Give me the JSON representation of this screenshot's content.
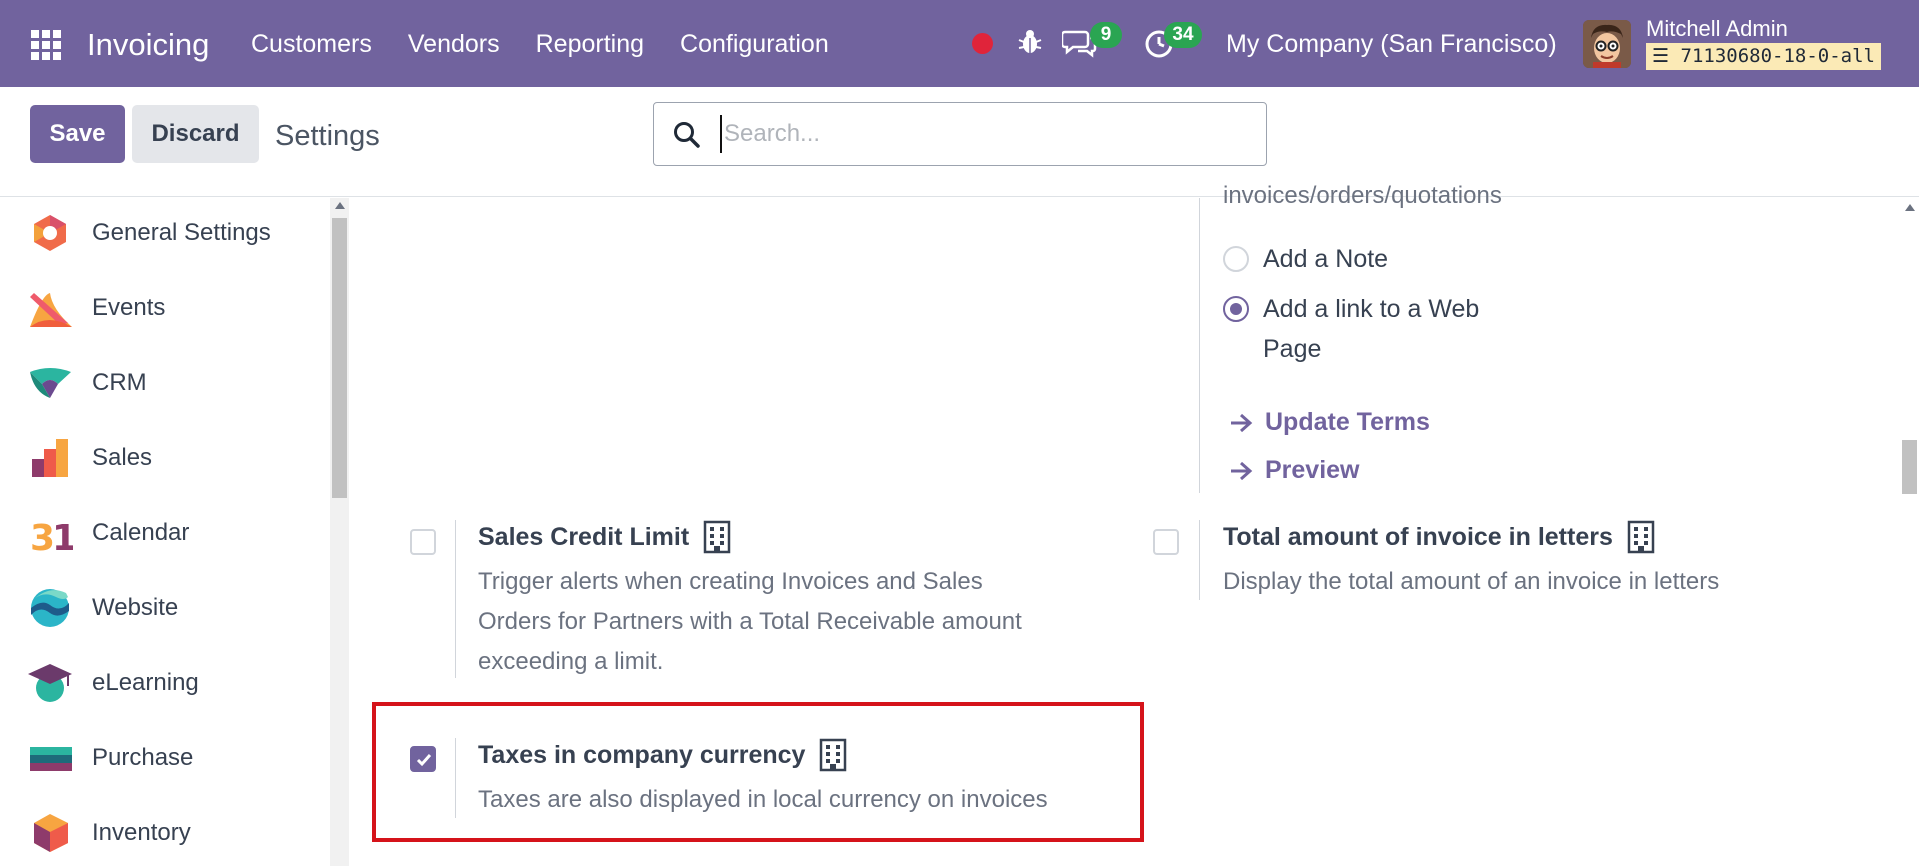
{
  "navbar": {
    "app_name": "Invoicing",
    "menu": [
      "Customers",
      "Vendors",
      "Reporting",
      "Configuration"
    ],
    "chat_badge": "9",
    "activity_badge": "34",
    "company": "My Company (San Francisco)",
    "user_name": "Mitchell Admin",
    "db_name": "71130680-18-0-all",
    "icons": [
      "apps-grid-icon",
      "recording-dot-icon",
      "bug-icon",
      "chat-icon",
      "activity-clock-icon",
      "database-icon"
    ],
    "colors": {
      "navbar": "#71639e",
      "badge": "#2aa552",
      "recording": "#e0243a"
    }
  },
  "control": {
    "save_label": "Save",
    "discard_label": "Discard",
    "title": "Settings",
    "search_placeholder": "Search..."
  },
  "sidebar": {
    "items": [
      {
        "label": "General Settings",
        "icon": "general-settings-icon"
      },
      {
        "label": "Events",
        "icon": "events-icon"
      },
      {
        "label": "CRM",
        "icon": "crm-icon"
      },
      {
        "label": "Sales",
        "icon": "sales-icon"
      },
      {
        "label": "Calendar",
        "icon": "calendar-icon"
      },
      {
        "label": "Website",
        "icon": "website-icon"
      },
      {
        "label": "eLearning",
        "icon": "elearning-icon"
      },
      {
        "label": "Purchase",
        "icon": "purchase-icon"
      },
      {
        "label": "Inventory",
        "icon": "inventory-icon"
      }
    ]
  },
  "main": {
    "truncated_text": "invoices/orders/quotations",
    "radios": [
      {
        "label": "Add a Note",
        "checked": false
      },
      {
        "label_line1": "Add a link to a Web",
        "label_line2": "Page",
        "checked": true
      }
    ],
    "links": {
      "update_terms": "Update Terms",
      "preview": "Preview"
    },
    "settings": {
      "sales_credit_limit": {
        "title": "Sales Credit Limit",
        "desc": [
          "Trigger alerts when creating Invoices and Sales",
          "Orders for Partners with a Total Receivable amount",
          "exceeding a limit."
        ],
        "checked": false
      },
      "total_in_letters": {
        "title": "Total amount of invoice in letters",
        "desc": "Display the total amount of an invoice in letters",
        "checked": false
      },
      "taxes_company_currency": {
        "title": "Taxes in company currency",
        "desc": "Taxes are also displayed in local currency on invoices",
        "checked": true
      }
    },
    "colors": {
      "accent": "#71639e",
      "highlight_border": "#d5131a"
    }
  }
}
